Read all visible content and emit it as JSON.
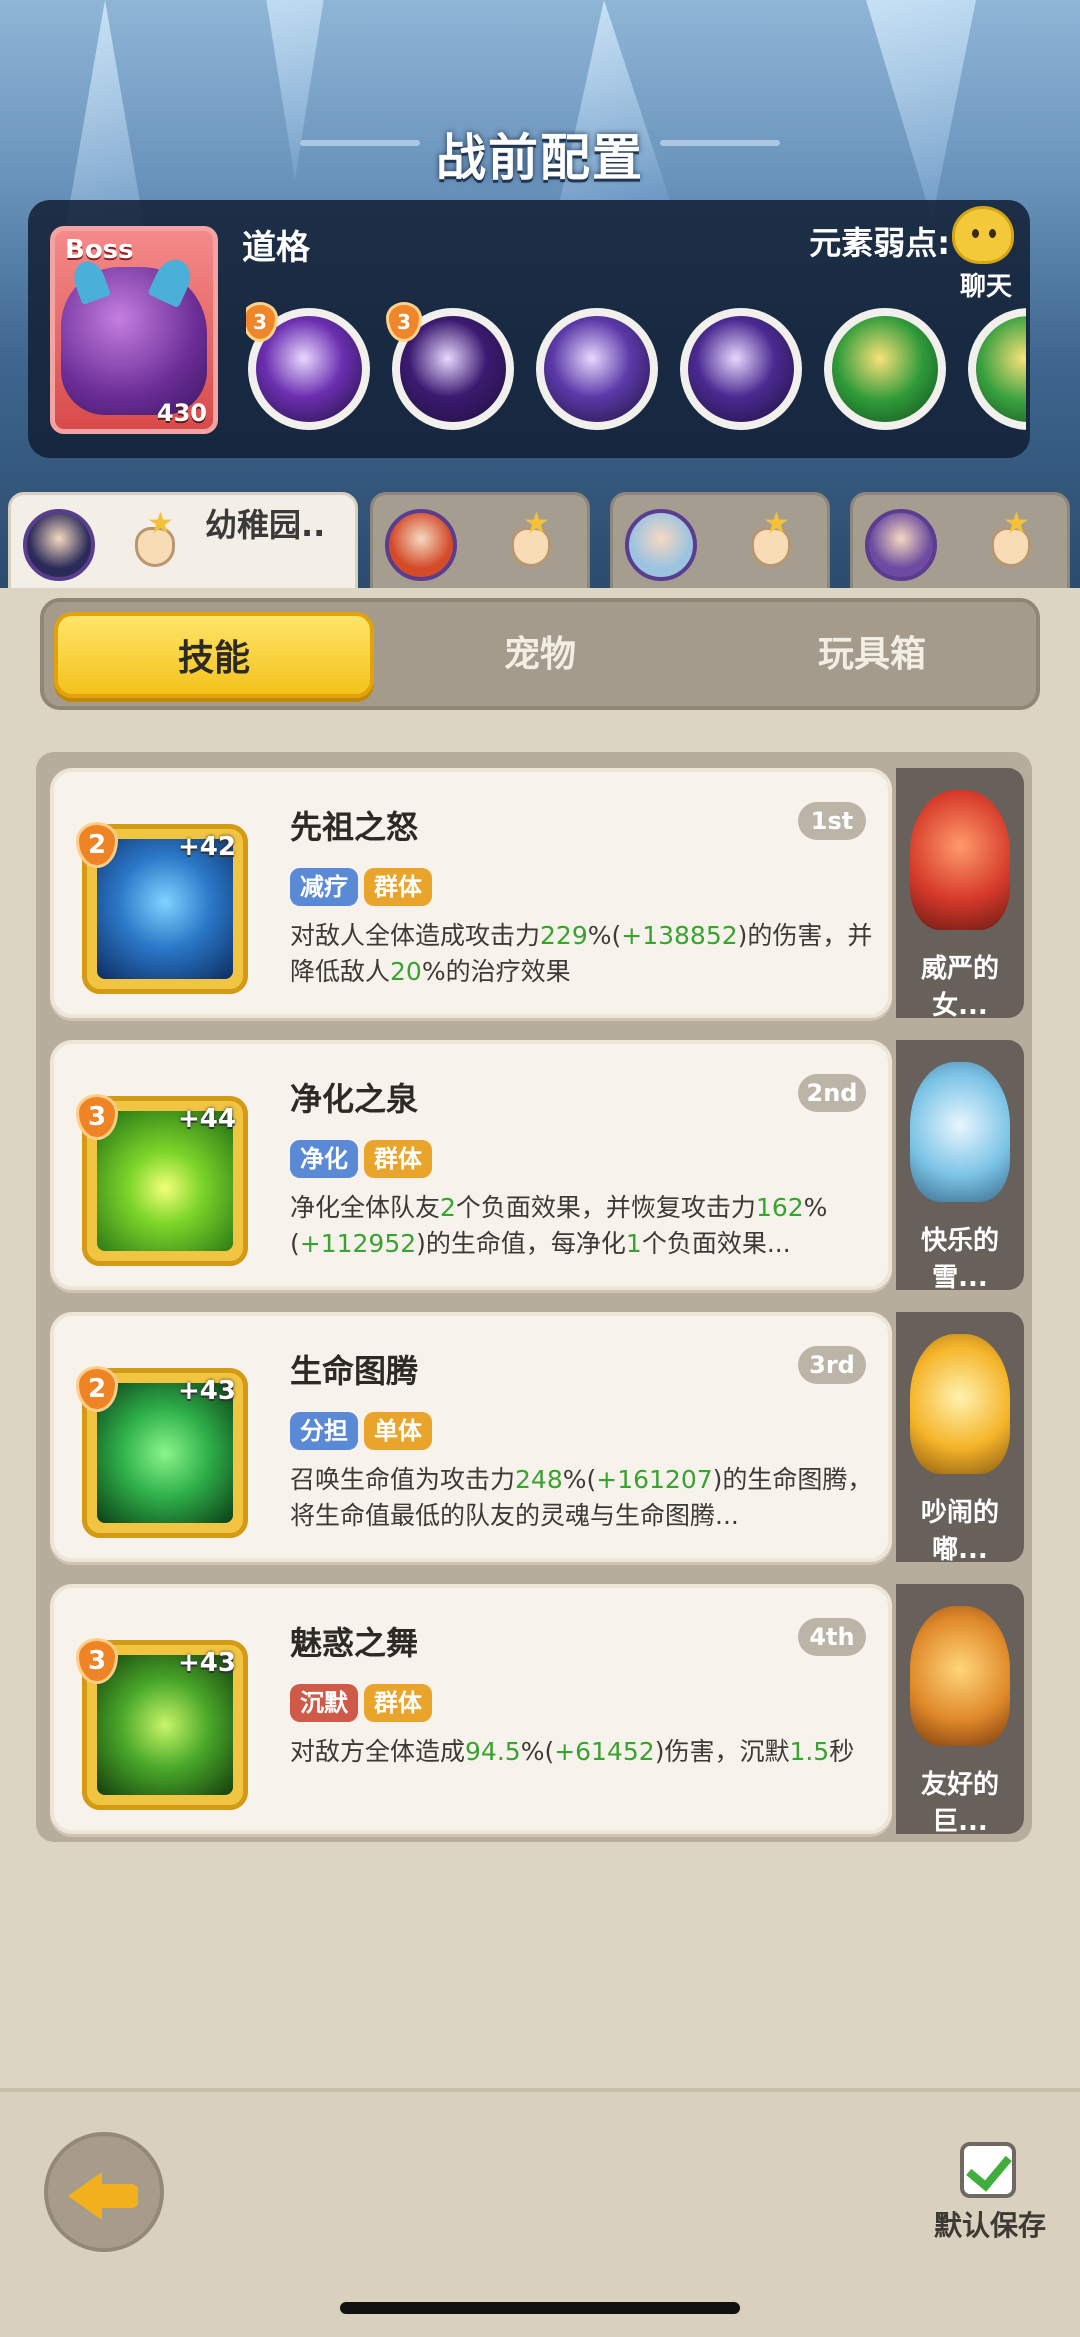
{
  "header": {
    "title": "战前配置"
  },
  "boss": {
    "tag": "Boss",
    "level": "430",
    "name": "道格",
    "weakness_label": "元素弱点:",
    "skills": [
      {
        "badge": "3",
        "icon": "purple-orb-icon",
        "color": "#6b2fb0"
      },
      {
        "badge": "3",
        "icon": "dark-burst-icon",
        "color": "#3b1a70"
      },
      {
        "badge": "",
        "icon": "ice-crystal-icon",
        "color": "#5b3aa8"
      },
      {
        "badge": "",
        "icon": "dragon-head-icon",
        "color": "#4a2a90"
      },
      {
        "badge": "",
        "icon": "hourglass-icon",
        "color": "#2f9a3a"
      },
      {
        "badge": "",
        "icon": "partial-green-icon",
        "color": "#3aa040"
      }
    ]
  },
  "chat": {
    "label": "聊天"
  },
  "hero_tabs": [
    {
      "name": "幼稚园..",
      "active": true,
      "avatar_color": "#2b2b5a"
    },
    {
      "name": "",
      "active": false,
      "avatar_color": "#d44b2a"
    },
    {
      "name": "",
      "active": false,
      "avatar_color": "#9cc3e0"
    },
    {
      "name": "",
      "active": false,
      "avatar_color": "#6c4ba0"
    }
  ],
  "segments": [
    {
      "label": "技能",
      "active": true
    },
    {
      "label": "宠物",
      "active": false
    },
    {
      "label": "玩具箱",
      "active": false
    }
  ],
  "skills": [
    {
      "name": "先祖之怒",
      "level": "2",
      "bonus": "+42",
      "rank": "1st",
      "icon": "totem-figure-icon",
      "tags": [
        {
          "label": "减疗",
          "color": "#5a8ad6"
        },
        {
          "label": "群体",
          "color": "#e8a42b"
        }
      ],
      "desc": [
        {
          "t": "对敌人全体造成攻击力",
          "g": false
        },
        {
          "t": "229",
          "g": true
        },
        {
          "t": "%(",
          "g": false
        },
        {
          "t": "+138852",
          "g": true
        },
        {
          "t": ")的伤害，并降低敌人",
          "g": false
        },
        {
          "t": "20",
          "g": true
        },
        {
          "t": "%的治疗效果",
          "g": false
        }
      ],
      "pet_name": "威严的女...",
      "pet_icon": "red-dragon-icon"
    },
    {
      "name": "净化之泉",
      "level": "3",
      "bonus": "+44",
      "rank": "2nd",
      "icon": "green-drop-icon",
      "tags": [
        {
          "label": "净化",
          "color": "#5a8ad6"
        },
        {
          "label": "群体",
          "color": "#e8a42b"
        }
      ],
      "desc": [
        {
          "t": "净化全体队友",
          "g": false
        },
        {
          "t": "2",
          "g": true
        },
        {
          "t": "个负面效果，并恢复攻击力",
          "g": false
        },
        {
          "t": "162",
          "g": true
        },
        {
          "t": "%(",
          "g": false
        },
        {
          "t": "+112952",
          "g": true
        },
        {
          "t": ")的生命值，每净化",
          "g": false
        },
        {
          "t": "1",
          "g": true
        },
        {
          "t": "个负面效果...",
          "g": false
        }
      ],
      "pet_name": "快乐的雪...",
      "pet_icon": "blue-bird-icon"
    },
    {
      "name": "生命图腾",
      "level": "2",
      "bonus": "+43",
      "rank": "3rd",
      "icon": "green-totem-icon",
      "tags": [
        {
          "label": "分担",
          "color": "#5a8ad6"
        },
        {
          "label": "单体",
          "color": "#e8a42b"
        }
      ],
      "desc": [
        {
          "t": "召唤生命值为攻击力",
          "g": false
        },
        {
          "t": "248",
          "g": true
        },
        {
          "t": "%(",
          "g": false
        },
        {
          "t": "+161207",
          "g": true
        },
        {
          "t": ")的生命图腾，将生命值最低的队友的灵魂与生命图腾...",
          "g": false
        }
      ],
      "pet_name": "吵闹的嘟...",
      "pet_icon": "pufferfish-icon"
    },
    {
      "name": "魅惑之舞",
      "level": "3",
      "bonus": "+43",
      "rank": "4th",
      "icon": "dancer-icon",
      "tags": [
        {
          "label": "沉默",
          "color": "#d05a48"
        },
        {
          "label": "群体",
          "color": "#e8a42b"
        }
      ],
      "desc": [
        {
          "t": "对敌方全体造成",
          "g": false
        },
        {
          "t": "94.5",
          "g": true
        },
        {
          "t": "%(",
          "g": false
        },
        {
          "t": "+61452",
          "g": true
        },
        {
          "t": ")伤害，沉默",
          "g": false
        },
        {
          "t": "1.5",
          "g": true
        },
        {
          "t": "秒",
          "g": false
        }
      ],
      "pet_name": "友好的巨...",
      "pet_icon": "crab-robot-icon"
    }
  ],
  "footer": {
    "back": "back-arrow-icon",
    "save_label": "默认保存"
  }
}
